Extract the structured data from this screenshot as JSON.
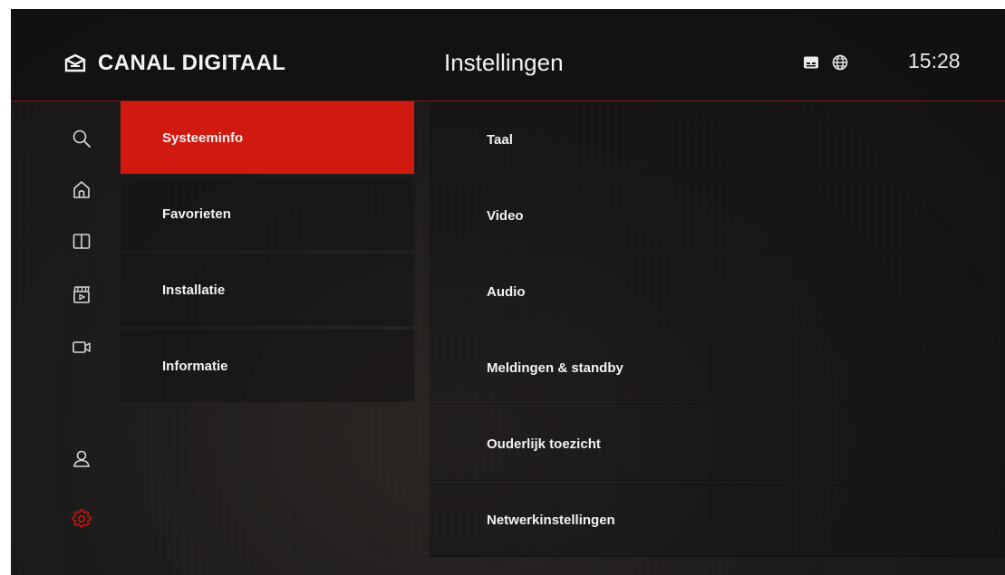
{
  "header": {
    "logo_text": "CANAL DIGITAAL",
    "page_title": "Instellingen",
    "clock": "15:28",
    "status_icons": [
      "subtitles-icon",
      "globe-icon"
    ]
  },
  "rail": {
    "items": [
      {
        "icon": "search-icon"
      },
      {
        "icon": "home-icon"
      },
      {
        "icon": "book-icon"
      },
      {
        "icon": "clapperboard-icon"
      },
      {
        "icon": "video-camera-icon"
      },
      {
        "icon": "user-icon"
      },
      {
        "icon": "gear-icon",
        "active": true
      }
    ]
  },
  "menu": {
    "items": [
      {
        "label": "Systeeminfo",
        "active": true
      },
      {
        "label": "Favorieten"
      },
      {
        "label": "Installatie"
      },
      {
        "label": "Informatie"
      }
    ]
  },
  "submenu": {
    "items": [
      {
        "label": "Taal"
      },
      {
        "label": "Video"
      },
      {
        "label": "Audio"
      },
      {
        "label": "Meldingen & standby"
      },
      {
        "label": "Ouderlijk toezicht"
      },
      {
        "label": "Netwerkinstellingen"
      }
    ]
  },
  "colors": {
    "accent": "#d0190f",
    "header_line": "#7c1a14",
    "text": "#f2f2f2",
    "icon": "#d8d8d8"
  }
}
